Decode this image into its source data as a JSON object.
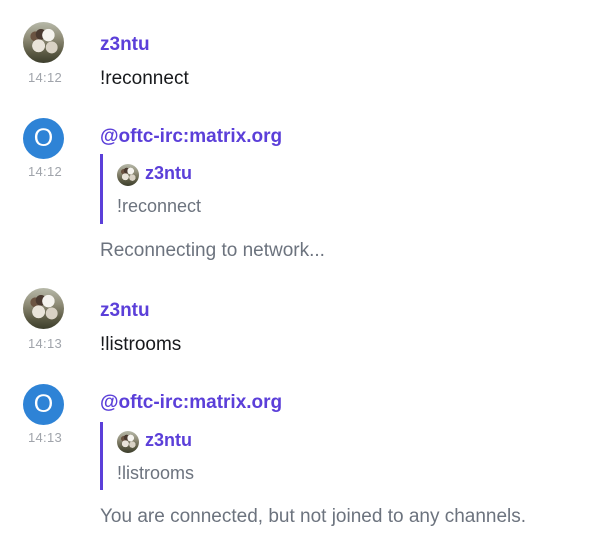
{
  "timeline": {
    "events": [
      {
        "sender": "z3ntu",
        "avatar_icon": "cat-photo-avatar",
        "time": "14:12",
        "body": "!reconnect"
      },
      {
        "sender": "@oftc-irc:matrix.org",
        "avatar_letter": "O",
        "avatar_color": "#2e83d6",
        "time": "14:12",
        "reply_to": {
          "sender": "z3ntu",
          "body": "!reconnect"
        },
        "body": "Reconnecting to network..."
      },
      {
        "sender": "z3ntu",
        "avatar_icon": "cat-photo-avatar",
        "time": "14:13",
        "body": "!listrooms"
      },
      {
        "sender": "@oftc-irc:matrix.org",
        "avatar_letter": "O",
        "avatar_color": "#2e83d6",
        "time": "14:13",
        "reply_to": {
          "sender": "z3ntu",
          "body": "!listrooms"
        },
        "body": "You are connected, but not joined to any channels."
      }
    ]
  },
  "colors": {
    "sender": "#5b3fd9",
    "timestamp": "#a0a4ab",
    "notice_text": "#6c737e",
    "reply_border": "#5b3fd9"
  }
}
